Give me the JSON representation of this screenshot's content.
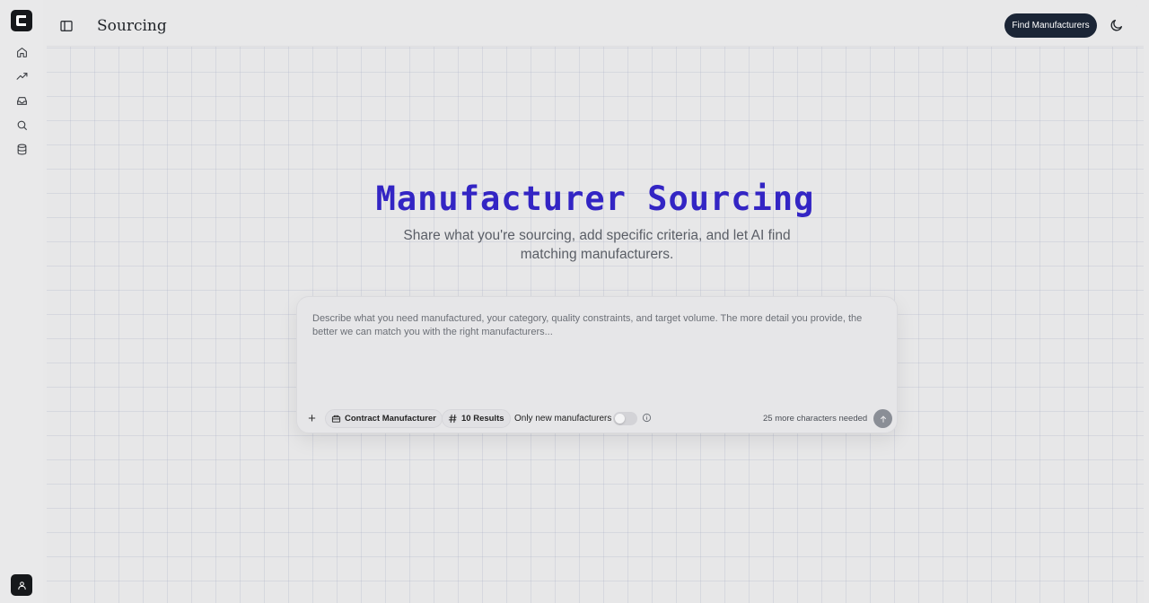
{
  "app": {
    "logo_letter": "C"
  },
  "rail": {
    "items": [
      {
        "name": "home",
        "icon": "home-icon"
      },
      {
        "name": "trends",
        "icon": "trending-up-icon"
      },
      {
        "name": "inbox",
        "icon": "inbox-icon"
      },
      {
        "name": "search",
        "icon": "search-icon"
      },
      {
        "name": "database",
        "icon": "database-icon"
      }
    ],
    "avatar_icon": "user-icon"
  },
  "header": {
    "title": "Sourcing",
    "primary_button": "Find Manufacturers",
    "theme_icon": "moon-icon"
  },
  "hero": {
    "title": "Manufacturer Sourcing",
    "subtitle": "Share what you're sourcing, add specific criteria, and let AI find matching manufacturers."
  },
  "composer": {
    "placeholder": "Describe what you need manufactured, your category, quality constraints, and target volume. The more detail you provide, the better we can match you with the right manufacturers...",
    "value": "",
    "manufacturer_type": "Contract Manufacturer",
    "results_count": "10 Results",
    "toggle_label": "Only new manufacturers",
    "toggle_on": false,
    "chars_needed": "25 more characters needed"
  },
  "colors": {
    "accent": "#3325c4",
    "primary_button_bg": "#1b2536",
    "background": "#e8e8e9"
  }
}
